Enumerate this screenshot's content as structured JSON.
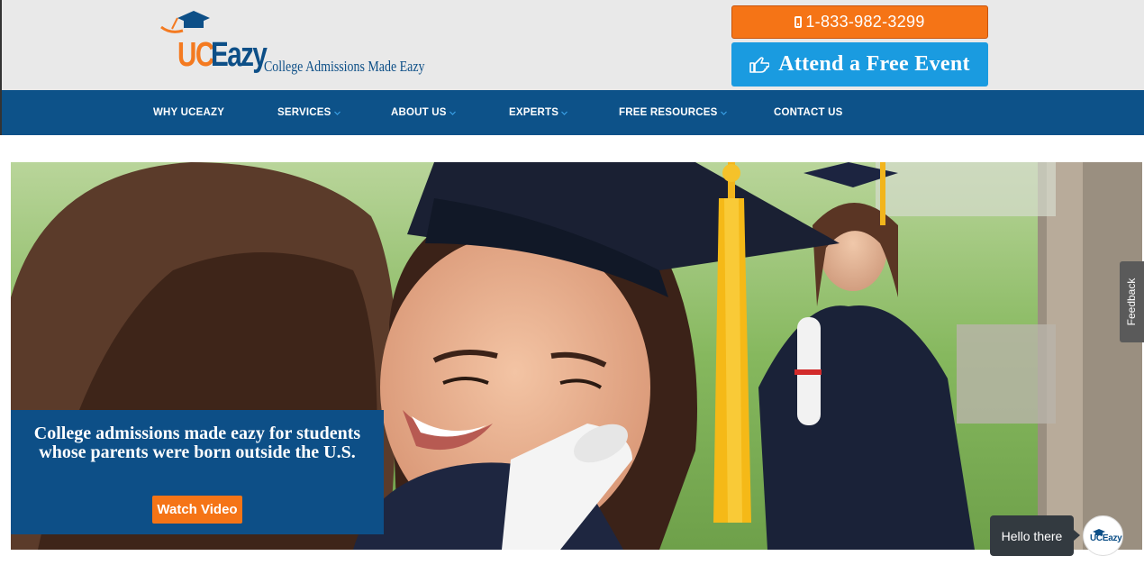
{
  "header": {
    "logo": {
      "brand_uc": "UC",
      "brand_eazy": "Eazy",
      "tagline": "College Admissions Made Eazy"
    },
    "phone_label": "1-833-982-3299",
    "event_label": "Attend a Free Event"
  },
  "nav": {
    "items": [
      {
        "label": "WHY UCEAZY",
        "dropdown": false
      },
      {
        "label": "SERVICES",
        "dropdown": true
      },
      {
        "label": "ABOUT US",
        "dropdown": true
      },
      {
        "label": "EXPERTS",
        "dropdown": true
      },
      {
        "label": "FREE RESOURCES",
        "dropdown": true
      },
      {
        "label": "CONTACT US",
        "dropdown": false
      }
    ]
  },
  "hero": {
    "headline": "College admissions made eazy for students whose parents were born outside the U.S.",
    "button_label": "Watch Video"
  },
  "widgets": {
    "feedback_label": "Feedback",
    "chat_greeting": "Hello there",
    "chat_avatar_text": "UCEazy"
  },
  "colors": {
    "brand_blue": "#0d5289",
    "brand_orange": "#f57416",
    "accent_blue": "#1a9be0",
    "header_bg": "#e9e9e9"
  },
  "icons": {
    "phone": "mobile-phone-icon",
    "event": "hand-pointing-icon",
    "caret": "chevron-down-icon",
    "logo": "graduation-cap-logo"
  }
}
